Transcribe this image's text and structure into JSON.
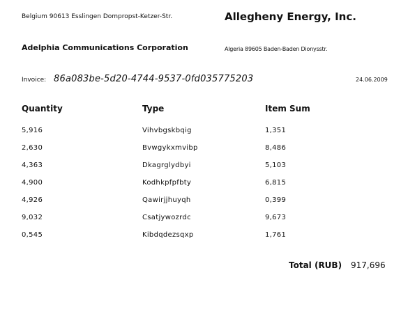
{
  "header": {
    "sender_address": "Belgium 90613 Esslingen Dompropst-Ketzer-Str.",
    "company_name": "Allegheny Energy, Inc.",
    "recipient_name": "Adelphia Communications Corporation",
    "recipient_address": "Algeria 89605 Baden-Baden Dionysstr."
  },
  "invoice": {
    "label": "Invoice:",
    "id": "86a083be-5d20-4744-9537-0fd035775203",
    "date": "24.06.2009"
  },
  "table": {
    "columns": [
      "Quantity",
      "Type",
      "Item Sum"
    ],
    "rows": [
      [
        "5,916",
        "Vihvbgskbqig",
        "1,351"
      ],
      [
        "2,630",
        "Bvwgykxmvibp",
        "8,486"
      ],
      [
        "4,363",
        "Dkagrglydbyi",
        "5,103"
      ],
      [
        "4,900",
        "Kodhkpfpfbty",
        "6,815"
      ],
      [
        "4,926",
        "Qawirjjhuyqh",
        "0,399"
      ],
      [
        "9,032",
        "Csatjywozrdc",
        "9,673"
      ],
      [
        "0,545",
        "Kibdqdezsqxp",
        "1,761"
      ]
    ]
  },
  "total": {
    "label": "Total (RUB)",
    "value": "917,696"
  }
}
